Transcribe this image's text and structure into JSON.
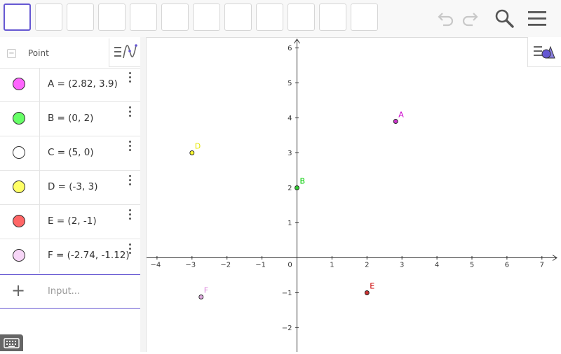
{
  "toolbar": {
    "tool_slots": 12,
    "undo_icon": "undo-icon",
    "redo_icon": "redo-icon",
    "search_icon": "search-icon",
    "menu_icon": "hamburger-menu-icon"
  },
  "algebra": {
    "group_label": "Point",
    "collapse_symbol": "−",
    "rows": [
      {
        "text": "A = (2.82, 3.9)",
        "color": "#ff66ff"
      },
      {
        "text": "B = (0, 2)",
        "color": "#66ff66"
      },
      {
        "text": "C = (5, 0)",
        "color": "#ffffff"
      },
      {
        "text": "D = (-3, 3)",
        "color": "#ffff66"
      },
      {
        "text": "E = (2, -1)",
        "color": "#ff6666"
      },
      {
        "text": "F = (-2.74, -1.12)",
        "color": "#f7d6f7"
      }
    ],
    "input_placeholder": "Input...",
    "input_plus": "+"
  },
  "graphics": {
    "x_ticks": [
      "−4",
      "−3",
      "−2",
      "−1",
      "0",
      "1",
      "2",
      "3",
      "4",
      "5",
      "6",
      "7"
    ],
    "y_ticks": [
      "6",
      "5",
      "4",
      "3",
      "2",
      "1",
      "−1",
      "−2"
    ],
    "x_range": [
      -4.4,
      7.5
    ],
    "y_range": [
      -2.5,
      6.3
    ],
    "points": [
      {
        "name": "A",
        "x": 2.82,
        "y": 3.9,
        "fill": "#cc33cc",
        "label_color": "#cc00cc"
      },
      {
        "name": "B",
        "x": 0,
        "y": 2,
        "fill": "#33cc33",
        "label_color": "#00cc00"
      },
      {
        "name": "D",
        "x": -3,
        "y": 3,
        "fill": "#ffff33",
        "label_color": "#e6e600"
      },
      {
        "name": "E",
        "x": 2,
        "y": -1,
        "fill": "#cc3333",
        "label_color": "#cc0000"
      },
      {
        "name": "F",
        "x": -2.74,
        "y": -1.12,
        "fill": "#ddaadd",
        "label_color": "#dd88dd"
      }
    ]
  },
  "colors": {
    "accent": "#6557d2"
  }
}
